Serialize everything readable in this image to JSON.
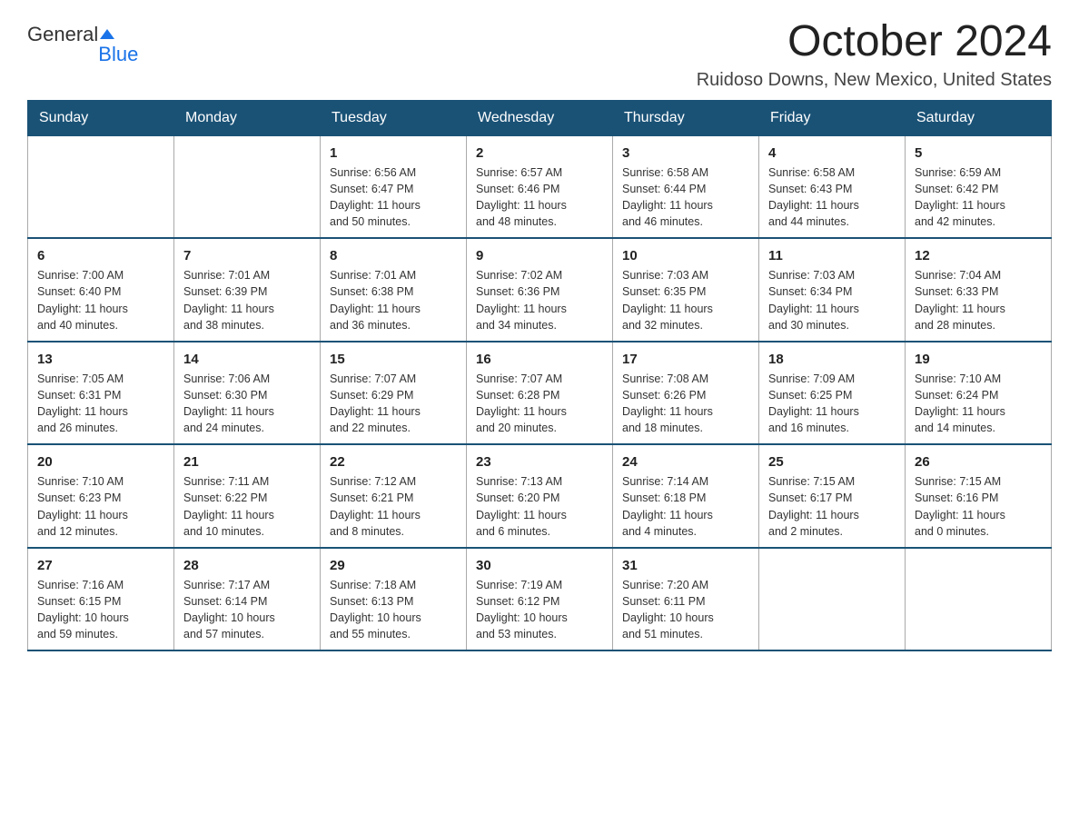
{
  "header": {
    "logo_general": "General",
    "logo_blue": "Blue",
    "month_year": "October 2024",
    "location": "Ruidoso Downs, New Mexico, United States"
  },
  "days_of_week": [
    "Sunday",
    "Monday",
    "Tuesday",
    "Wednesday",
    "Thursday",
    "Friday",
    "Saturday"
  ],
  "weeks": [
    [
      {
        "day": "",
        "info": ""
      },
      {
        "day": "",
        "info": ""
      },
      {
        "day": "1",
        "info": "Sunrise: 6:56 AM\nSunset: 6:47 PM\nDaylight: 11 hours\nand 50 minutes."
      },
      {
        "day": "2",
        "info": "Sunrise: 6:57 AM\nSunset: 6:46 PM\nDaylight: 11 hours\nand 48 minutes."
      },
      {
        "day": "3",
        "info": "Sunrise: 6:58 AM\nSunset: 6:44 PM\nDaylight: 11 hours\nand 46 minutes."
      },
      {
        "day": "4",
        "info": "Sunrise: 6:58 AM\nSunset: 6:43 PM\nDaylight: 11 hours\nand 44 minutes."
      },
      {
        "day": "5",
        "info": "Sunrise: 6:59 AM\nSunset: 6:42 PM\nDaylight: 11 hours\nand 42 minutes."
      }
    ],
    [
      {
        "day": "6",
        "info": "Sunrise: 7:00 AM\nSunset: 6:40 PM\nDaylight: 11 hours\nand 40 minutes."
      },
      {
        "day": "7",
        "info": "Sunrise: 7:01 AM\nSunset: 6:39 PM\nDaylight: 11 hours\nand 38 minutes."
      },
      {
        "day": "8",
        "info": "Sunrise: 7:01 AM\nSunset: 6:38 PM\nDaylight: 11 hours\nand 36 minutes."
      },
      {
        "day": "9",
        "info": "Sunrise: 7:02 AM\nSunset: 6:36 PM\nDaylight: 11 hours\nand 34 minutes."
      },
      {
        "day": "10",
        "info": "Sunrise: 7:03 AM\nSunset: 6:35 PM\nDaylight: 11 hours\nand 32 minutes."
      },
      {
        "day": "11",
        "info": "Sunrise: 7:03 AM\nSunset: 6:34 PM\nDaylight: 11 hours\nand 30 minutes."
      },
      {
        "day": "12",
        "info": "Sunrise: 7:04 AM\nSunset: 6:33 PM\nDaylight: 11 hours\nand 28 minutes."
      }
    ],
    [
      {
        "day": "13",
        "info": "Sunrise: 7:05 AM\nSunset: 6:31 PM\nDaylight: 11 hours\nand 26 minutes."
      },
      {
        "day": "14",
        "info": "Sunrise: 7:06 AM\nSunset: 6:30 PM\nDaylight: 11 hours\nand 24 minutes."
      },
      {
        "day": "15",
        "info": "Sunrise: 7:07 AM\nSunset: 6:29 PM\nDaylight: 11 hours\nand 22 minutes."
      },
      {
        "day": "16",
        "info": "Sunrise: 7:07 AM\nSunset: 6:28 PM\nDaylight: 11 hours\nand 20 minutes."
      },
      {
        "day": "17",
        "info": "Sunrise: 7:08 AM\nSunset: 6:26 PM\nDaylight: 11 hours\nand 18 minutes."
      },
      {
        "day": "18",
        "info": "Sunrise: 7:09 AM\nSunset: 6:25 PM\nDaylight: 11 hours\nand 16 minutes."
      },
      {
        "day": "19",
        "info": "Sunrise: 7:10 AM\nSunset: 6:24 PM\nDaylight: 11 hours\nand 14 minutes."
      }
    ],
    [
      {
        "day": "20",
        "info": "Sunrise: 7:10 AM\nSunset: 6:23 PM\nDaylight: 11 hours\nand 12 minutes."
      },
      {
        "day": "21",
        "info": "Sunrise: 7:11 AM\nSunset: 6:22 PM\nDaylight: 11 hours\nand 10 minutes."
      },
      {
        "day": "22",
        "info": "Sunrise: 7:12 AM\nSunset: 6:21 PM\nDaylight: 11 hours\nand 8 minutes."
      },
      {
        "day": "23",
        "info": "Sunrise: 7:13 AM\nSunset: 6:20 PM\nDaylight: 11 hours\nand 6 minutes."
      },
      {
        "day": "24",
        "info": "Sunrise: 7:14 AM\nSunset: 6:18 PM\nDaylight: 11 hours\nand 4 minutes."
      },
      {
        "day": "25",
        "info": "Sunrise: 7:15 AM\nSunset: 6:17 PM\nDaylight: 11 hours\nand 2 minutes."
      },
      {
        "day": "26",
        "info": "Sunrise: 7:15 AM\nSunset: 6:16 PM\nDaylight: 11 hours\nand 0 minutes."
      }
    ],
    [
      {
        "day": "27",
        "info": "Sunrise: 7:16 AM\nSunset: 6:15 PM\nDaylight: 10 hours\nand 59 minutes."
      },
      {
        "day": "28",
        "info": "Sunrise: 7:17 AM\nSunset: 6:14 PM\nDaylight: 10 hours\nand 57 minutes."
      },
      {
        "day": "29",
        "info": "Sunrise: 7:18 AM\nSunset: 6:13 PM\nDaylight: 10 hours\nand 55 minutes."
      },
      {
        "day": "30",
        "info": "Sunrise: 7:19 AM\nSunset: 6:12 PM\nDaylight: 10 hours\nand 53 minutes."
      },
      {
        "day": "31",
        "info": "Sunrise: 7:20 AM\nSunset: 6:11 PM\nDaylight: 10 hours\nand 51 minutes."
      },
      {
        "day": "",
        "info": ""
      },
      {
        "day": "",
        "info": ""
      }
    ]
  ]
}
